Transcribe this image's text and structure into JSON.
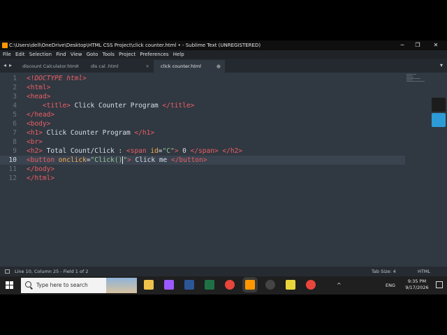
{
  "window": {
    "title": "C:\\Users\\dell\\OneDrive\\Desktop\\HTML CSS Project\\click counter.html • - Sublime Text (UNREGISTERED)",
    "minimize": "─",
    "maximize": "❐",
    "close": "✕"
  },
  "menu": [
    "File",
    "Edit",
    "Selection",
    "Find",
    "View",
    "Goto",
    "Tools",
    "Project",
    "Preferences",
    "Help"
  ],
  "tabs": [
    {
      "label": "discount Calculator.html",
      "close": "×",
      "active": false
    },
    {
      "label": "dis cal .html",
      "close": "×",
      "active": false
    },
    {
      "label": "click counter.html",
      "close": "●",
      "active": true
    }
  ],
  "tabbar": {
    "nav_left": "◂",
    "nav_right": "▸",
    "menu": "▾"
  },
  "editor": {
    "current_line": 10,
    "line_numbers": [
      "1",
      "2",
      "3",
      "4",
      "5",
      "6",
      "7",
      "8",
      "9",
      "10",
      "11",
      "12"
    ],
    "lines": [
      [
        {
          "t": "<!",
          "c": "tg"
        },
        {
          "t": "DOCTYPE html",
          "c": "tgi"
        },
        {
          "t": ">",
          "c": "tg"
        }
      ],
      [
        {
          "t": "<html>",
          "c": "tg"
        }
      ],
      [
        {
          "t": "<head>",
          "c": "tg"
        }
      ],
      [
        {
          "t": "    ",
          "c": "pl"
        },
        {
          "t": "<title>",
          "c": "tg"
        },
        {
          "t": " Click Counter Program ",
          "c": "pl"
        },
        {
          "t": "</title>",
          "c": "tg"
        }
      ],
      [
        {
          "t": "</head>",
          "c": "tg"
        }
      ],
      [
        {
          "t": "<body>",
          "c": "tg"
        }
      ],
      [
        {
          "t": "<h1>",
          "c": "tg"
        },
        {
          "t": " Click Counter Program ",
          "c": "pl"
        },
        {
          "t": "</h1>",
          "c": "tg"
        }
      ],
      [
        {
          "t": "<br>",
          "c": "tg"
        }
      ],
      [
        {
          "t": "<h2>",
          "c": "tg"
        },
        {
          "t": " Total Count/Click : ",
          "c": "pl"
        },
        {
          "t": "<span ",
          "c": "tg"
        },
        {
          "t": "id",
          "c": "at"
        },
        {
          "t": "=",
          "c": "pl"
        },
        {
          "t": "\"C\"",
          "c": "st"
        },
        {
          "t": ">",
          "c": "tg"
        },
        {
          "t": " 0 ",
          "c": "pl"
        },
        {
          "t": "</span>",
          "c": "tg"
        },
        {
          "t": " ",
          "c": "pl"
        },
        {
          "t": "</h2>",
          "c": "tg"
        }
      ],
      [
        {
          "t": "<button ",
          "c": "tg"
        },
        {
          "t": "onclick",
          "c": "at"
        },
        {
          "t": "=",
          "c": "pl"
        },
        {
          "t": "\"Click()",
          "c": "st"
        },
        {
          "t": "|",
          "c": "cursor"
        },
        {
          "t": "\"",
          "c": "st"
        },
        {
          "t": ">",
          "c": "tg"
        },
        {
          "t": " Click me ",
          "c": "pl"
        },
        {
          "t": "</button>",
          "c": "tg"
        }
      ],
      [
        {
          "t": "</body>",
          "c": "tg"
        }
      ],
      [
        {
          "t": "</html>",
          "c": "tg"
        }
      ]
    ]
  },
  "status": {
    "position": "Line 10, Column 25 - Field 1 of 2",
    "tab_size": "Tab Size: 4",
    "syntax": "HTML"
  },
  "taskbar": {
    "search_placeholder": "Type here to search",
    "icons": [
      "file-explorer-icon",
      "copilot-icon",
      "word-icon",
      "excel-icon",
      "chrome-icon",
      "sublime-text-icon",
      "obs-icon",
      "paint-icon",
      "chrome-icon-2"
    ],
    "icon_colors": [
      "#f0c24b",
      "#9b59ff",
      "#2b5797",
      "#1e7145",
      "#e8453c",
      "#ff9800",
      "#444444",
      "#e8d53c",
      "#e8453c"
    ],
    "tray_chevron": "^",
    "language": "ENG",
    "time": "9:35 PM",
    "date": "9/17/2026"
  },
  "colors": {
    "editor_bg": "#303841",
    "tag": "#ec5f66",
    "attr": "#f9ae58",
    "string": "#99c794",
    "text": "#d8dee9"
  }
}
